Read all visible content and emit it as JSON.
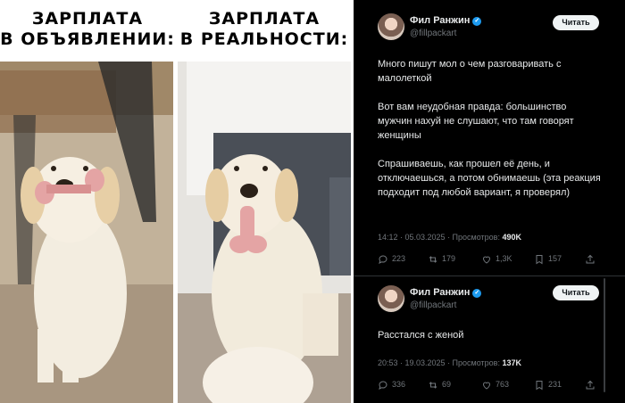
{
  "meme": {
    "caption_left": "ЗАРПЛАТА\nВ ОБЪЯВЛЕНИИ:",
    "caption_right": "ЗАРПЛАТА\nВ РЕАЛЬНОСТИ:"
  },
  "tweets": [
    {
      "author": "Фил Ранжин",
      "handle": "@fillpackart",
      "follow_label": "Читать",
      "paragraphs": [
        "Много пишут мол о чем разговаривать с малолеткой",
        "Вот вам неудобная правда: большинство мужчин нахуй не слушают, что там говорят женщины",
        "Спрашиваешь, как прошел её день, и отключаешься, а потом обнимаешь (эта реакция подходит под любой вариант, я проверял)"
      ],
      "time": "14:12 · 05.03.2025 · Просмотров: ",
      "views": "490K",
      "replies": "223",
      "retweets": "179",
      "likes": "1,3K",
      "bookmarks": "157"
    },
    {
      "author": "Фил Ранжин",
      "handle": "@fillpackart",
      "follow_label": "Читать",
      "paragraphs": [
        "Расстался с женой"
      ],
      "time": "20:53 · 19.03.2025 · Просмотров: ",
      "views": "137K",
      "replies": "336",
      "retweets": "69",
      "likes": "763",
      "bookmarks": "231"
    }
  ],
  "icons": [
    "verified-badge-icon",
    "reply-icon",
    "retweet-icon",
    "like-icon",
    "bookmark-icon",
    "share-icon"
  ],
  "colors": {
    "accent": "#1d9bf0",
    "background": "#000000",
    "muted": "#71767b"
  }
}
